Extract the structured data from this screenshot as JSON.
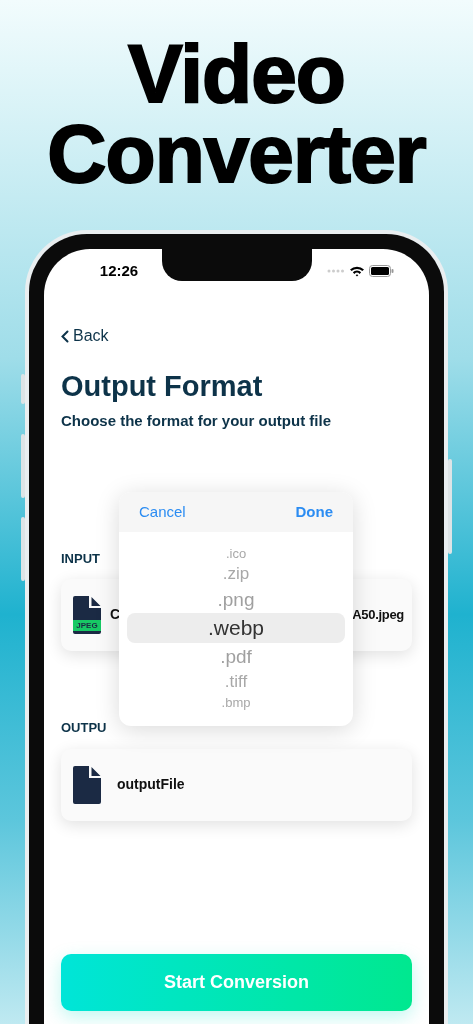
{
  "headline": [
    "Video",
    "Converter"
  ],
  "status_bar": {
    "time": "12:26"
  },
  "nav": {
    "back": "Back"
  },
  "title": "Output Format",
  "subtitle": "Choose the format for your output file",
  "input": {
    "label": "INPUT",
    "badge": "JPEG",
    "name_start": "C",
    "name_end": "A50.jpeg"
  },
  "output": {
    "label": "OUTPU",
    "name": "outputFile"
  },
  "picker": {
    "cancel": "Cancel",
    "done": "Done",
    "options": [
      {
        "label": ".ico",
        "selected": false
      },
      {
        "label": ".zip",
        "selected": false
      },
      {
        "label": ".png",
        "selected": false
      },
      {
        "label": ".webp",
        "selected": true
      },
      {
        "label": ".pdf",
        "selected": false
      },
      {
        "label": ".tiff",
        "selected": false
      },
      {
        "label": ".bmp",
        "selected": false
      }
    ]
  },
  "button": "Start Conversion"
}
